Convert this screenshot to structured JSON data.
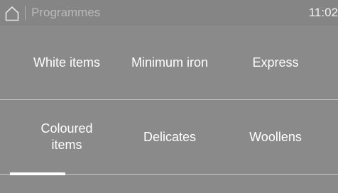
{
  "header": {
    "home_icon": "home-icon",
    "title": "Programmes",
    "time": "11:02"
  },
  "programmes": {
    "row1": [
      "White items",
      "Minimum iron",
      "Express"
    ],
    "row2": [
      "Coloured items",
      "Delicates",
      "Woollens"
    ]
  },
  "pager": {
    "current_page": 1
  },
  "colors": {
    "background": "#8a8a8a",
    "header_bg": "#858585",
    "text": "#ffffff",
    "title_text": "#b9b9b9",
    "divider": "#c8c8c8",
    "indicator": "#ffffff"
  }
}
